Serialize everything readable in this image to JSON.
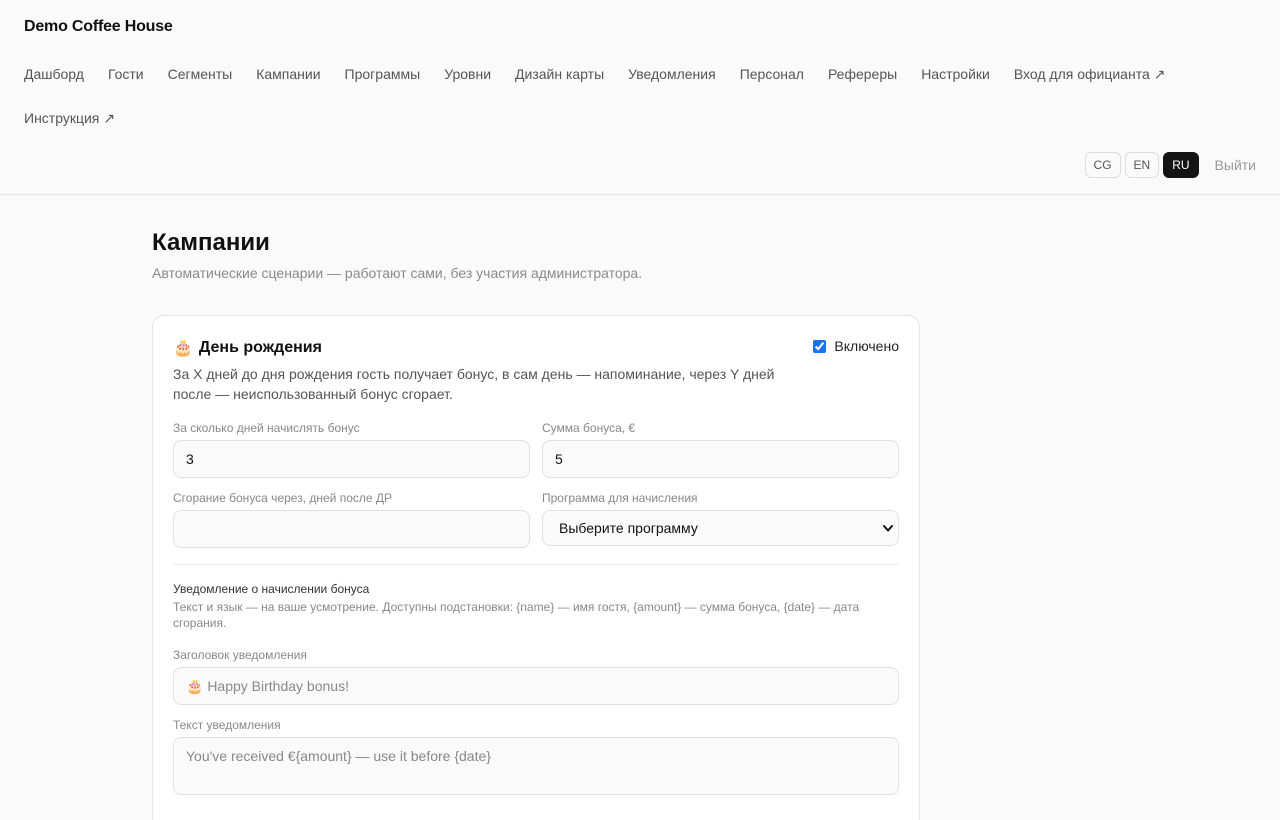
{
  "app": {
    "brand": "Demo Coffee House"
  },
  "nav": {
    "items": [
      "Дашборд",
      "Гости",
      "Сегменты",
      "Кампании",
      "Программы",
      "Уровни",
      "Дизайн карты",
      "Уведомления",
      "Персонал",
      "Рефереры",
      "Настройки",
      "Вход для официанта ↗",
      "Инструкция ↗"
    ]
  },
  "languages": {
    "items": [
      "CG",
      "EN",
      "RU"
    ],
    "active": "RU"
  },
  "logout_label": "Выйти",
  "page": {
    "title": "Кампании",
    "subtitle": "Автоматические сценарии — работают сами, без участия администратора."
  },
  "campaign": {
    "icon": "birthday-cake-icon",
    "icon_glyph": "🎂",
    "title": "День рождения",
    "enabled_label": "Включено",
    "enabled": true,
    "description": "За X дней до дня рождения гость получает бонус, в сам день — напоминание, через Y дней после — неиспользованный бонус сгорает.",
    "fields": {
      "days_before": {
        "label": "За сколько дней начислять бонус",
        "value": "3"
      },
      "bonus_amount": {
        "label": "Сумма бонуса, €",
        "value": "5"
      },
      "expire_days": {
        "label": "Сгорание бонуса через, дней после ДР",
        "value": ""
      },
      "program": {
        "label": "Программа для начисления",
        "selected": "Выберите программу"
      }
    },
    "notification": {
      "section_title": "Уведомление о начислении бонуса",
      "section_desc": "Текст и язык — на ваше усмотрение. Доступны подстановки: {name} — имя гостя, {amount} — сумма бонуса, {date} — дата сгорания.",
      "title_label": "Заголовок уведомления",
      "title_placeholder": "🎂 Happy Birthday bonus!",
      "body_label": "Текст уведомления",
      "body_placeholder": "You've received €{amount} — use it before {date}"
    }
  },
  "colors": {
    "accent": "#1a73e8",
    "active_lang_bg": "#141414",
    "page_bg": "#fafafa",
    "card_bg": "#ffffff"
  }
}
